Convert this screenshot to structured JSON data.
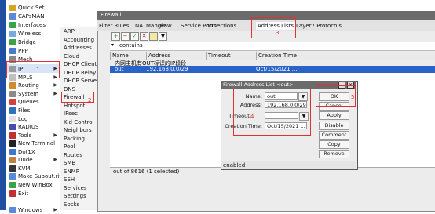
{
  "sidebar": {
    "items": [
      {
        "label": "Quick Set",
        "arrow": false,
        "color": "#d9a520"
      },
      {
        "label": "CAPsMAN",
        "arrow": false,
        "color": "#5a8ad8"
      },
      {
        "label": "Interfaces",
        "arrow": false,
        "color": "#3aa34a"
      },
      {
        "label": "Wireless",
        "arrow": false,
        "color": "#7aa7dd"
      },
      {
        "label": "Bridge",
        "arrow": false,
        "color": "#3aa34a"
      },
      {
        "label": "PPP",
        "arrow": false,
        "color": "#4a7ad0"
      },
      {
        "label": "Mesh",
        "arrow": false,
        "color": "#888888"
      },
      {
        "label": "IP",
        "arrow": true,
        "color": "#9a9a9a"
      },
      {
        "label": "MPLS",
        "arrow": true,
        "color": "#bfbfbf"
      },
      {
        "label": "Routing",
        "arrow": true,
        "color": "#d08a30"
      },
      {
        "label": "System",
        "arrow": true,
        "color": "#8a8a8a"
      },
      {
        "label": "Queues",
        "arrow": false,
        "color": "#d24040"
      },
      {
        "label": "Files",
        "arrow": false,
        "color": "#2e6fbf"
      },
      {
        "label": "Log",
        "arrow": false,
        "color": "#e0e0e0"
      },
      {
        "label": "RADIUS",
        "arrow": false,
        "color": "#4a4ab0"
      },
      {
        "label": "Tools",
        "arrow": true,
        "color": "#c03030"
      },
      {
        "label": "New Terminal",
        "arrow": false,
        "color": "#222222"
      },
      {
        "label": "Dot1X",
        "arrow": false,
        "color": "#3a7ad0"
      },
      {
        "label": "Dude",
        "arrow": true,
        "color": "#c08040"
      },
      {
        "label": "KVM",
        "arrow": false,
        "color": "#333333"
      },
      {
        "label": "Make Supout.rif",
        "arrow": false,
        "color": "#5a8ad8"
      },
      {
        "label": "New WinBox",
        "arrow": false,
        "color": "#3aa34a"
      },
      {
        "label": "Exit",
        "arrow": false,
        "color": "#c03030"
      },
      {
        "label": "Windows",
        "arrow": true,
        "color": "#5a8ad8"
      }
    ]
  },
  "submenu": {
    "items": [
      "ARP",
      "Accounting",
      "Addresses",
      "Cloud",
      "DHCP Client",
      "DHCP Relay",
      "DHCP Server",
      "DNS",
      "Firewall",
      "Hotspot",
      "IPsec",
      "Kid Control",
      "Neighbors",
      "Packing",
      "Pool",
      "Routes",
      "SMB",
      "SNMP",
      "SSH",
      "Services",
      "Settings",
      "Socks"
    ]
  },
  "window": {
    "title": "Firewall",
    "tabs": [
      "Filter Rules",
      "NAT",
      "Mangle",
      "Raw",
      "Service Ports",
      "Connections",
      "Address Lists",
      "Layer7 Protocols"
    ],
    "filter_text": "contains",
    "columns": [
      "Name",
      "Address",
      "Timeout",
      "Creation Time"
    ],
    "comment_row": "内网主机有OUT标识的IP段段",
    "data_row": {
      "name": "out",
      "address": "192.168.0.0/29",
      "timeout": "",
      "creation": "Oct/15/2021 ..."
    },
    "status": "out of 8616 (1 selected)"
  },
  "dialog": {
    "title": "Firewall Address List <out>",
    "fields": {
      "name_label": "Name:",
      "name_value": "out",
      "address_label": "Address:",
      "address_value": "192.168.0.0/29",
      "timeout_label": "Timeout:",
      "timeout_value": "",
      "creation_label": "Creation Time:",
      "creation_value": "Oct/15/2021 ..."
    },
    "buttons": [
      "OK",
      "Cancel",
      "Apply",
      "Disable",
      "Comment",
      "Copy",
      "Remove"
    ],
    "status": "enabled"
  },
  "annotations": [
    "1",
    "2",
    "3",
    "4",
    "5"
  ],
  "colors": {
    "annotation": "#e23030",
    "selection": "#2a63c6",
    "titlebar": "#6b6b6b"
  }
}
